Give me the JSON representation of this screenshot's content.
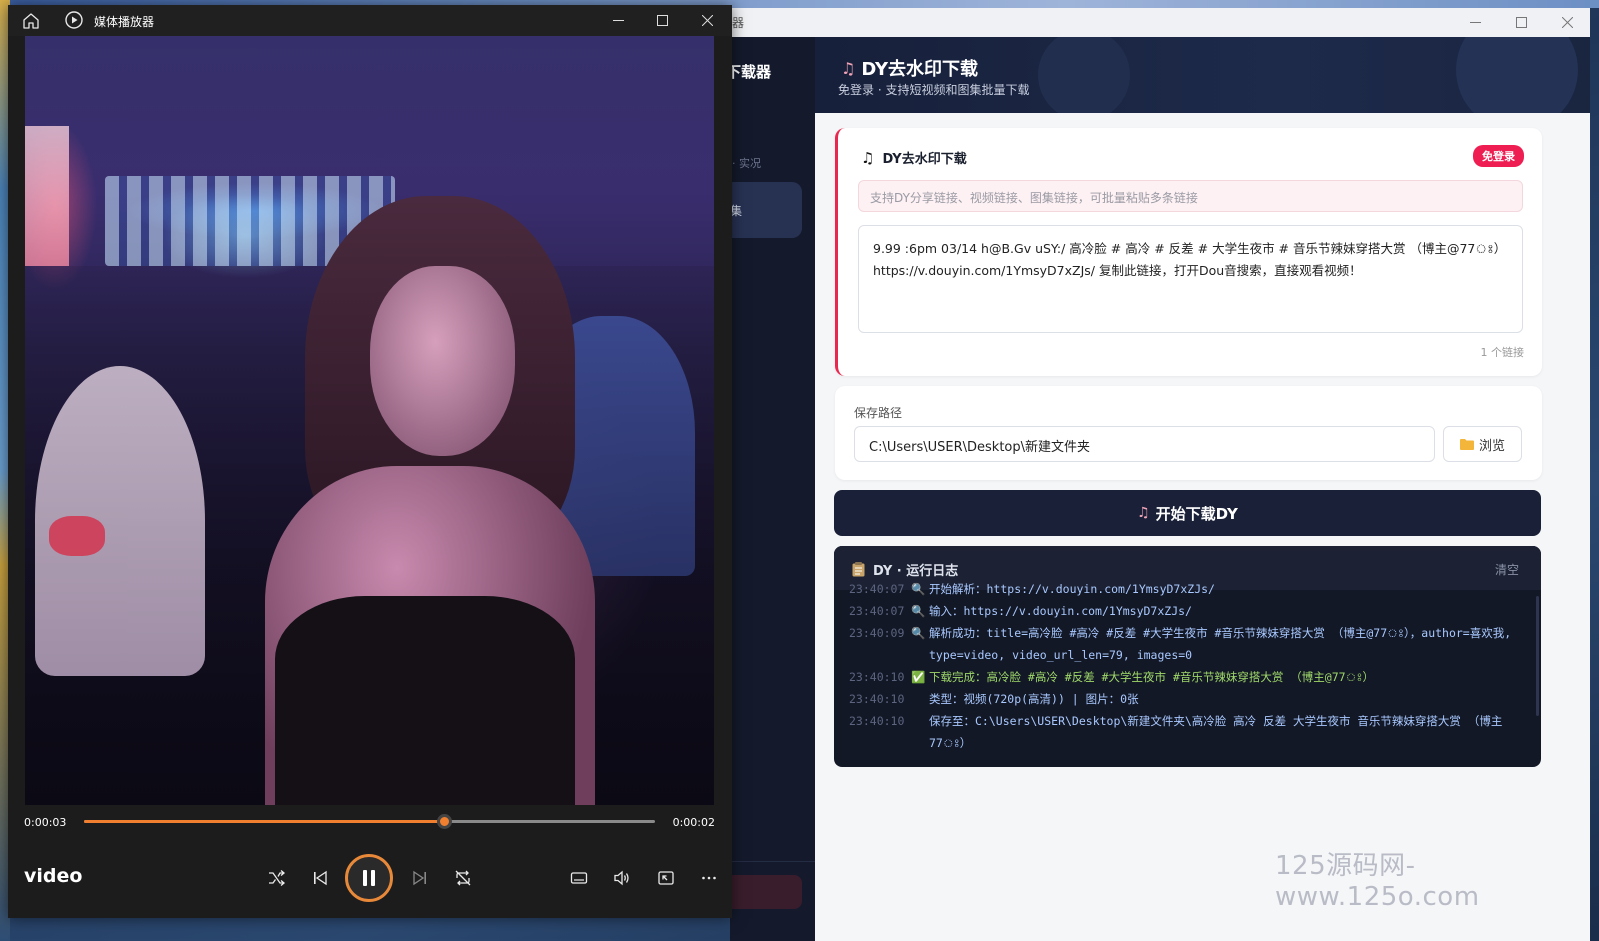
{
  "player": {
    "title": "媒体播放器",
    "media_name": "video",
    "time_current": "0:00:03",
    "time_total": "0:00:02",
    "progress_fraction": 0.63,
    "state": "playing",
    "accent_color": "#f08030"
  },
  "downloader": {
    "window_title_fragment": "器",
    "sidebar": {
      "app_name_fragment": "下载器",
      "section_label_fragment": "· 实况",
      "active_item_fragment": "集"
    },
    "header": {
      "title": "DY去水印下载",
      "subtitle": "免登录 · 支持短视频和图集批量下载"
    },
    "input_card": {
      "title": "DY去水印下载",
      "badge": "免登录",
      "hint": "支持DY分享链接、视频链接、图集链接，可批量粘贴多条链接",
      "link_text": "9.99 :6pm 03/14 h@B.Gv uSY:/ 高冷脸 # 高冷 # 反差 # 大学生夜市 # 音乐节辣妹穿搭大赏 （博主@77ঃ）https://v.douyin.com/1YmsyD7xZJs/ 复制此链接，打开Dou音搜索，直接观看视频！",
      "count": "1 个链接"
    },
    "path_card": {
      "label": "保存路径",
      "value": "C:\\Users\\USER\\Desktop\\新建文件夹",
      "browse_label": "浏览"
    },
    "start_button": "开始下载DY",
    "log": {
      "title": "DY · 运行日志",
      "clear_label": "清空",
      "lines": [
        {
          "ts": "23:40:07",
          "icon": "🔍",
          "text": "开始解析：https://v.douyin.com/1YmsyD7xZJs/"
        },
        {
          "ts": "23:40:07",
          "icon": "🔍",
          "text": "输入：https://v.douyin.com/1YmsyD7xZJs/"
        },
        {
          "ts": "23:40:09",
          "icon": "🔍",
          "text": "解析成功：title=高冷脸 #高冷 #反差 #大学生夜市 #音乐节辣妹穿搭大赏 （博主@77ঃ），author=喜欢我, type=video, video_url_len=79, images=0"
        },
        {
          "ts": "23:40:10",
          "icon": "✅",
          "text": "下载完成：高冷脸 #高冷 #反差 #大学生夜市 #音乐节辣妹穿搭大赏 （博主@77ঃ）"
        },
        {
          "ts": "23:40:10",
          "icon": "",
          "text": "类型：视频(720p(高清)) | 图片：0张"
        },
        {
          "ts": "23:40:10",
          "icon": "",
          "text": "保存至：C:\\Users\\USER\\Desktop\\新建文件夹\\高冷脸 高冷 反差 大学生夜市 音乐节辣妹穿搭大赏 （博主77ঃ）"
        }
      ]
    },
    "watermark": "125源码网-www.125o.com",
    "accent_color": "#ee1d52"
  }
}
